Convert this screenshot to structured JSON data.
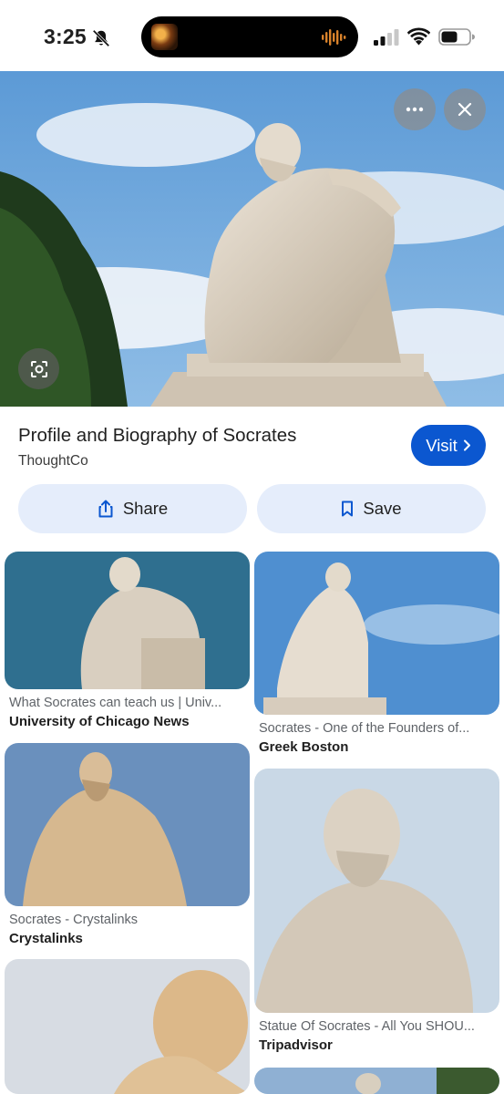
{
  "status_bar": {
    "time": "3:25",
    "icons": [
      "bell-slash-icon",
      "signal-icon",
      "wifi-icon",
      "battery-icon"
    ]
  },
  "hero": {
    "more_icon": "more-horizontal-icon",
    "close_icon": "close-icon",
    "lens_icon": "lens-search-icon"
  },
  "result": {
    "title": "Profile and Biography of Socrates",
    "source": "ThoughtCo",
    "visit_label": "Visit",
    "share_label": "Share",
    "save_label": "Save"
  },
  "colors": {
    "accent": "#0b57d0",
    "chip_bg": "#e5edfb",
    "caption": "#5f6368"
  },
  "results_grid": [
    {
      "caption": "What Socrates can teach us | Univ...",
      "source": "University of Chicago News"
    },
    {
      "caption": "Socrates - One of the Founders of...",
      "source": "Greek Boston"
    },
    {
      "caption": "Socrates - Crystalinks",
      "source": "Crystalinks"
    },
    {
      "caption": "Statue Of Socrates - All You SHOU...",
      "source": "Tripadvisor"
    },
    {
      "caption": "",
      "source": ""
    },
    {
      "caption": "",
      "source": ""
    }
  ]
}
